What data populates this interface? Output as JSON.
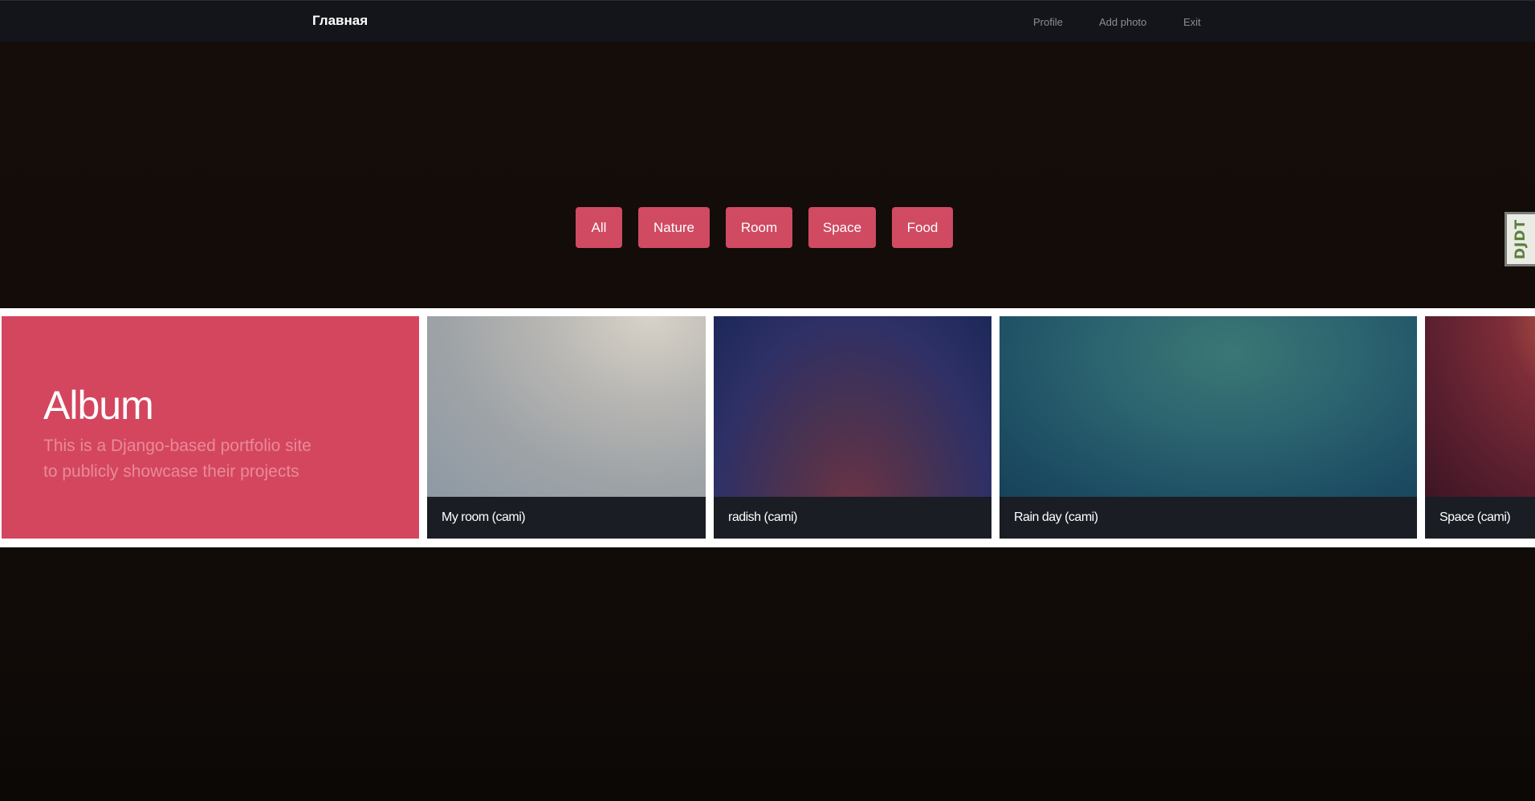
{
  "navbar": {
    "brand": "Главная",
    "links": {
      "profile": "Profile",
      "add_photo": "Add photo",
      "exit": "Exit"
    }
  },
  "filters": [
    "All",
    "Nature",
    "Room",
    "Space",
    "Food"
  ],
  "debug_toolbar": {
    "label": "DJDT"
  },
  "album": {
    "title": "Album",
    "description": "This is a Django-based portfolio site to publicly showcase their projects"
  },
  "photos": [
    {
      "caption": "My room (cami)"
    },
    {
      "caption": "radish (cami)"
    },
    {
      "caption": "Rain day (cami)"
    },
    {
      "caption": "Space (cami)"
    }
  ],
  "colors": {
    "accent": "#d04a62",
    "album_bg": "#d4465e",
    "navbar_bg": "#13151a",
    "page_bg": "#120c08"
  }
}
